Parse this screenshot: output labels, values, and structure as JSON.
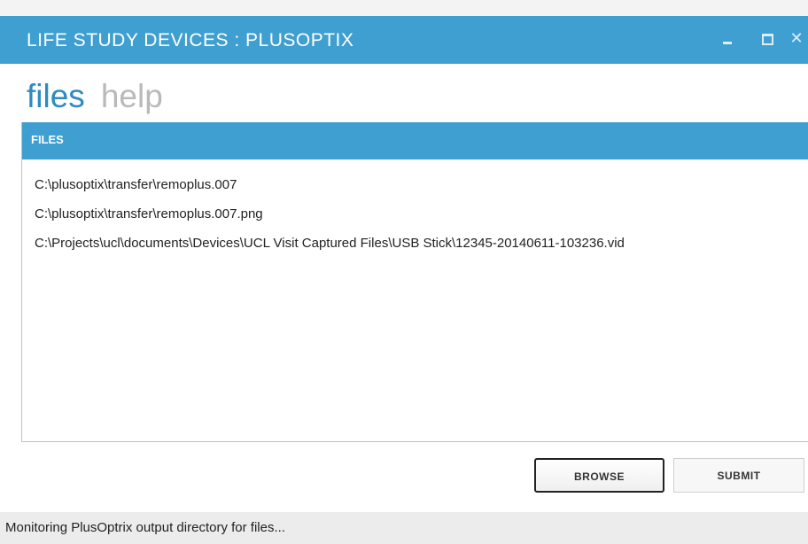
{
  "window": {
    "title": "LIFE STUDY DEVICES : PLUSOPTIX",
    "controls": {
      "minimize_icon": "minimize-icon",
      "maximize_icon": "maximize-icon",
      "close_icon": "close-icon",
      "close_glyph": "✕"
    }
  },
  "nav": {
    "items": [
      {
        "label": "files",
        "active": true
      },
      {
        "label": "help",
        "active": false
      }
    ]
  },
  "files_panel": {
    "header": "FILES",
    "files": [
      "C:\\plusoptix\\transfer\\remoplus.007",
      "C:\\plusoptix\\transfer\\remoplus.007.png",
      "C:\\Projects\\ucl\\documents\\Devices\\UCL Visit Captured Files\\USB Stick\\12345-20140611-103236.vid"
    ]
  },
  "buttons": {
    "browse_label": "BROWSE",
    "submit_label": "SUBMIT"
  },
  "status": {
    "text": "Monitoring PlusOptrix output directory for files..."
  },
  "colors": {
    "accent": "#3e9fd0",
    "active_nav": "#2d8bc0",
    "inactive_nav": "#b9b9b9"
  }
}
